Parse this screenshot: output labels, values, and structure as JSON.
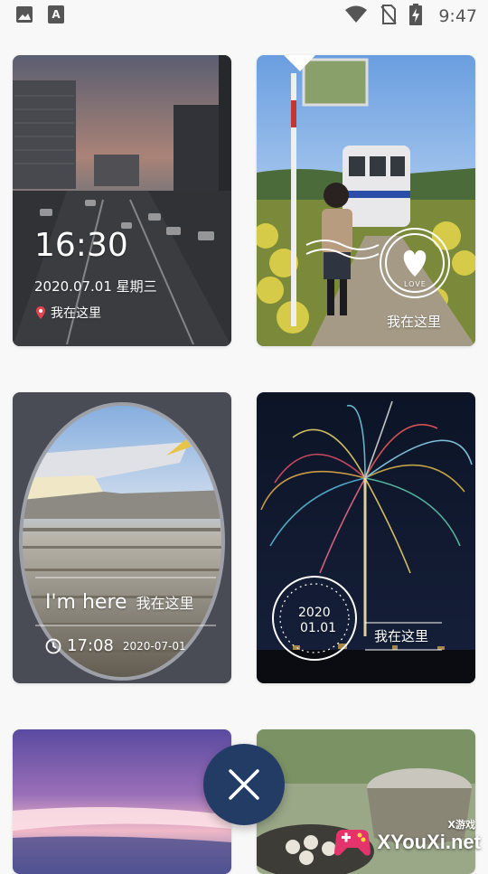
{
  "status_bar": {
    "time": "9:47",
    "left_icons": [
      "image-icon",
      "text-a-icon"
    ],
    "right_icons": [
      "wifi-icon",
      "no-sim-icon",
      "battery-charging-icon"
    ]
  },
  "templates": [
    {
      "time": "16:30",
      "date": "2020.07.01 星期三",
      "location": "我在这里"
    },
    {
      "label": "我在这里",
      "stamp_text": "LOVE"
    },
    {
      "title_en": "I'm here",
      "title_cn": "我在这里",
      "time": "17:08",
      "date": "2020-07-01"
    },
    {
      "stamp_year": "2020",
      "stamp_date": "01.01",
      "label": "我在这里"
    },
    {},
    {}
  ],
  "fab": {
    "icon": "close-icon"
  },
  "watermark": {
    "small": "X游戏",
    "text": "XYouXi.net"
  },
  "colors": {
    "fab": "#233c66",
    "background": "#f8f8f8"
  }
}
